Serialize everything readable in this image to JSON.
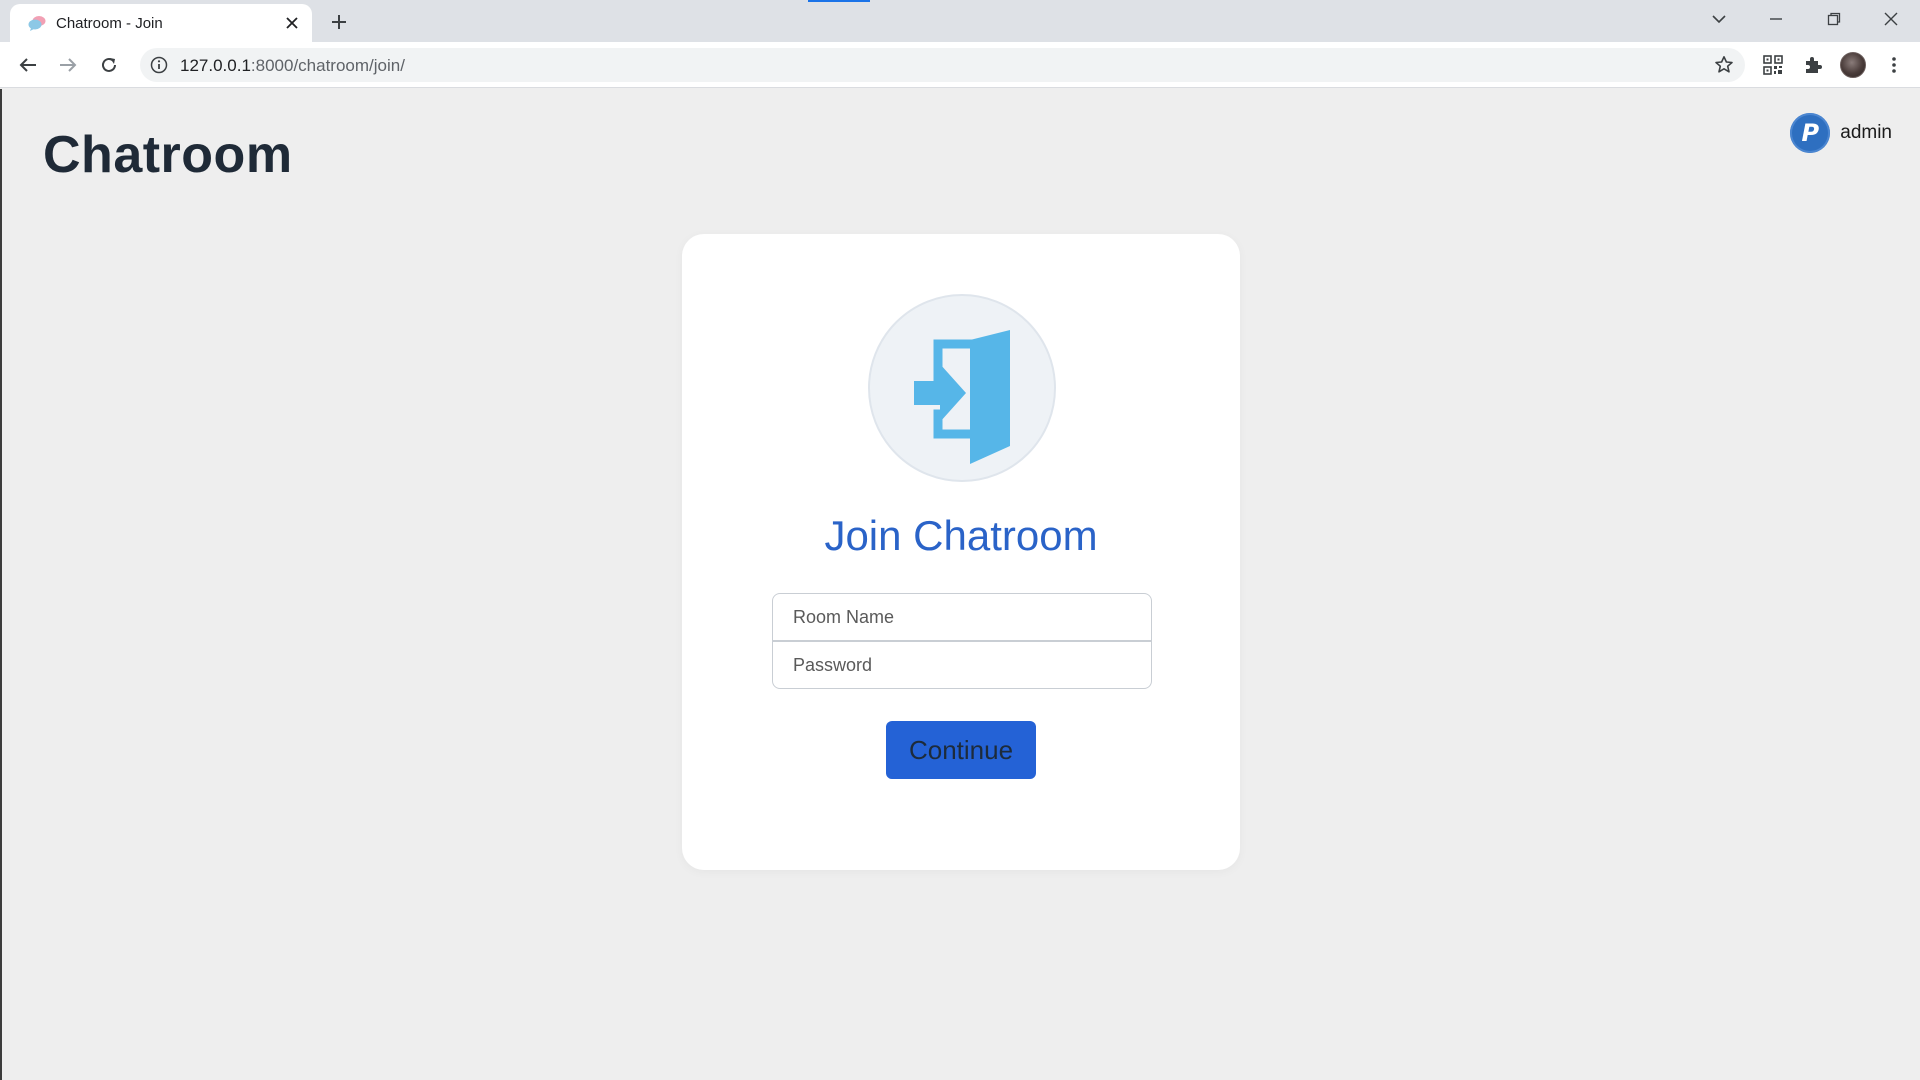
{
  "browser": {
    "tab_title": "Chatroom - Join",
    "url_host": "127.0.0.1",
    "url_path": ":8000/chatroom/join/",
    "accent_color": "#1a73e8"
  },
  "header": {
    "site_title": "Chatroom",
    "user_initial": "P",
    "user_name": "admin"
  },
  "join_card": {
    "title": "Join Chatroom",
    "room_name_placeholder": "Room Name",
    "password_placeholder": "Password",
    "continue_label": "Continue",
    "primary_color": "#2462d6",
    "icon": "door-enter-icon"
  }
}
